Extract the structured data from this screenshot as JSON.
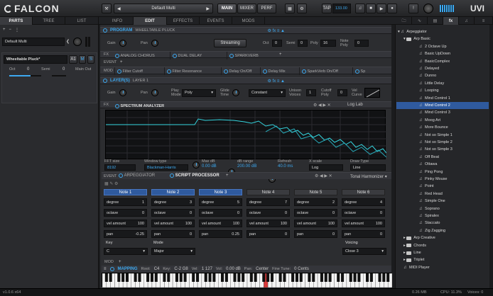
{
  "app": {
    "name": "FALCON",
    "preset": "Default Multi",
    "version": "v1.0.6 x64",
    "memory": "0.26 MB",
    "cpu": "CPU: 11.3%",
    "voices": "Voices: 0"
  },
  "top": {
    "main": "MAIN",
    "mixer": "MIXER",
    "perf": "PERF",
    "tap": "TAP",
    "tempo": "133.00"
  },
  "tabs": {
    "left": [
      "PARTS",
      "TREE",
      "LIST"
    ],
    "main": [
      "INFO",
      "EDIT",
      "EFFECTS",
      "EVENTS",
      "MODS"
    ]
  },
  "part": {
    "name": "Default Multi",
    "program": "Wheeltable Pluck*",
    "channel": "A1",
    "octave": "Oct",
    "octave_val": "0",
    "semi": "Semi",
    "semi_val": "0",
    "output": "Main Out"
  },
  "program": {
    "title": "PROGRAM",
    "name": "WHEELTABLE PLUCK",
    "gain": "Gain",
    "pan": "Pan",
    "streaming": "Streaming",
    "oct": "Oct",
    "oct_val": "0",
    "semi": "Semi",
    "semi_val": "0",
    "poly": "Poly",
    "poly_val": "16",
    "note_poly": "Note Poly",
    "note_poly_val": "0"
  },
  "fx": {
    "label": "FX",
    "items": [
      "ANALOG CHORUS",
      "DUAL DELAY",
      "SPARKVERB"
    ]
  },
  "event": {
    "label": "EVENT"
  },
  "mod": {
    "label": "MOD",
    "items": [
      "Filter Cutoff",
      "Filter Resonance",
      "Delay On/Off",
      "Delay Mix",
      "SparkVerb On/Off",
      "Sp"
    ]
  },
  "layer": {
    "title": "LAYER(S)",
    "name": "LAYER 1",
    "gain": "Gain",
    "pan": "Pan",
    "play_mode": "Play Mode",
    "play_mode_val": "Poly",
    "glide_time": "Glide Time",
    "glide": "Constant",
    "unison": "Unison Voices",
    "unison_val": "1",
    "cutoff_poly": "Cutoff Poly",
    "cutoff_poly_val": "0",
    "vel_curve": "Vel Curve"
  },
  "layer_fx": {
    "label": "FX",
    "name": "SPECTRUM ANALYZER",
    "view": "Log Lab"
  },
  "analyzer": {
    "fft_label": "FFT size",
    "fft": "8192",
    "window_label": "Window type",
    "window": "Blackman-Harris",
    "maxdb_label": "Max dB",
    "maxdb": "0.00 dB",
    "range_label": "dB range",
    "range": "200.00 dB",
    "refresh_label": "Refresh",
    "refresh": "40.0 ms",
    "xscale_label": "X scale",
    "xscale": "Log",
    "draw_label": "Draw Type",
    "draw": "Line"
  },
  "layer_event": {
    "label": "EVENT",
    "arp": "ARPEGGIATOR",
    "script": "SCRIPT PROCESSOR",
    "preset": "Tonal Harmonizer"
  },
  "notes": [
    {
      "name": "Note 1",
      "degree": "1",
      "octave": "0",
      "vel": "100",
      "pan": "-0.25",
      "on": true
    },
    {
      "name": "Note 2",
      "degree": "3",
      "octave": "0",
      "vel": "100",
      "pan": "0",
      "on": true
    },
    {
      "name": "Note 3",
      "degree": "5",
      "octave": "0",
      "vel": "100",
      "pan": "0.25",
      "on": true
    },
    {
      "name": "Note 4",
      "degree": "7",
      "octave": "0",
      "vel": "100",
      "pan": "0",
      "on": false
    },
    {
      "name": "Note 5",
      "degree": "2",
      "octave": "0",
      "vel": "100",
      "pan": "0",
      "on": false
    },
    {
      "name": "Note 6",
      "degree": "4",
      "octave": "0",
      "vel": "100",
      "pan": "0",
      "on": false
    }
  ],
  "note_labels": {
    "degree": "degree",
    "octave": "octave",
    "vel": "vel amount",
    "pan": "pan"
  },
  "key": {
    "label": "Key",
    "value": "C",
    "mode_label": "Mode",
    "mode": "Major",
    "voicing_label": "Voicing",
    "voicing": "Close 3"
  },
  "mod_bottom": {
    "label": "MOD"
  },
  "mapping": {
    "label": "MAPPING",
    "root_label": "Root:",
    "root": "C4",
    "key_label": "Key:",
    "key": "C-2 G8",
    "vel_label": "Vel:",
    "vel": "1 127",
    "vol_label": "Vol:",
    "vol": "0.00 dB",
    "pan_label": "Pan:",
    "pan": "Center",
    "tune_label": "Fine Tune:",
    "tune": "0 Cents"
  },
  "browser": {
    "root": "Arpeggiator",
    "sub": "Arp Basic",
    "items": [
      "2 Octave Up",
      "Basic UpDown",
      "BasicComplex",
      "Delayed",
      "Dunno",
      "Little Delay",
      "Looping",
      "Mind Control 1",
      "Mind Control 2",
      "Mind Control 3",
      "Moog Art",
      "More Bounce",
      "Not so Simple 1",
      "Not so Simple 2",
      "Not so Simple 3",
      "Off Beat",
      "Ottawa",
      "Ping Pong",
      "Pinky Mouse",
      "Point",
      "Red Head",
      "Simple One",
      "Soprano",
      "Spiralex",
      "Staccato",
      "Zig Zagging"
    ],
    "selected": "Mind Control 2",
    "folders": [
      "Arp Creative",
      "Chords",
      "Line",
      "Triplet"
    ],
    "player": "MIDI Player"
  },
  "colors": {
    "accent": "#3da9f0",
    "selected": "#2f5a9e",
    "spectrum": "#35d6e0"
  }
}
